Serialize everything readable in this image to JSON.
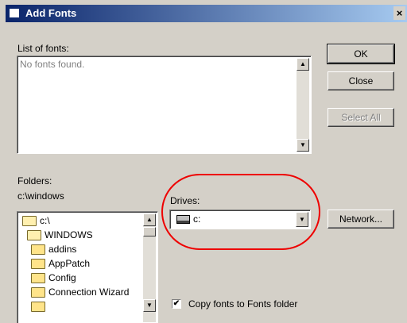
{
  "window": {
    "title": "Add Fonts",
    "close_glyph": "×"
  },
  "fonts_list": {
    "label": "List of fonts:",
    "empty_text": "No fonts found."
  },
  "buttons": {
    "ok": "OK",
    "close": "Close",
    "select_all": "Select All",
    "network": "Network..."
  },
  "folders": {
    "label": "Folders:",
    "current_path": "c:\\windows",
    "tree": [
      {
        "label": "c:\\",
        "icon": "open-folder-icon"
      },
      {
        "label": "WINDOWS",
        "icon": "open-folder-icon"
      },
      {
        "label": "addins",
        "icon": "folder-icon"
      },
      {
        "label": "AppPatch",
        "icon": "folder-icon"
      },
      {
        "label": "Config",
        "icon": "folder-icon"
      },
      {
        "label": "Connection Wizard",
        "icon": "folder-icon"
      }
    ]
  },
  "drives": {
    "label": "Drives:",
    "selected": "c:"
  },
  "copy_option": {
    "label": "Copy fonts to Fonts folder",
    "checked": true
  },
  "colors": {
    "title_start": "#0a246a",
    "title_end": "#a6caf0",
    "face": "#d4d0c8",
    "annotation": "#e00000"
  }
}
